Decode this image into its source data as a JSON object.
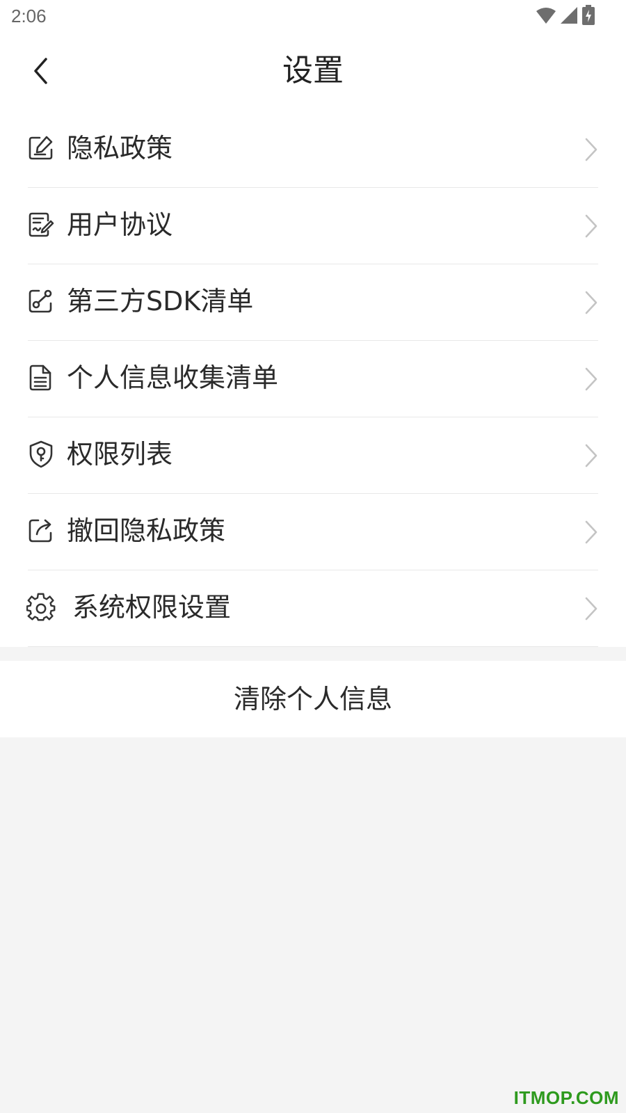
{
  "status_bar": {
    "time": "2:06",
    "icons": [
      "wifi-icon",
      "signal-icon",
      "battery-charging-icon"
    ]
  },
  "header": {
    "title": "设置",
    "back_icon": "chevron-left-icon"
  },
  "menu": {
    "items": [
      {
        "label": "隐私政策",
        "icon": "privacy-edit-icon"
      },
      {
        "label": "用户协议",
        "icon": "agreement-sign-icon"
      },
      {
        "label": "第三方SDK清单",
        "icon": "share-link-icon"
      },
      {
        "label": "个人信息收集清单",
        "icon": "document-list-icon"
      },
      {
        "label": "权限列表",
        "icon": "shield-key-icon"
      },
      {
        "label": "撤回隐私政策",
        "icon": "revoke-share-icon"
      },
      {
        "label": "系统权限设置",
        "icon": "gear-icon"
      }
    ],
    "chevron_icon": "chevron-right-icon"
  },
  "clear_button": {
    "label": "清除个人信息"
  },
  "watermark": {
    "text": "ITMOP.COM"
  },
  "colors": {
    "page_background": "#f4f4f4",
    "card_background": "#ffffff",
    "text_primary": "#2a2a2a",
    "divider": "#e8e8e8",
    "chevron": "#c4c4c4",
    "watermark": "#2e9a1e"
  }
}
